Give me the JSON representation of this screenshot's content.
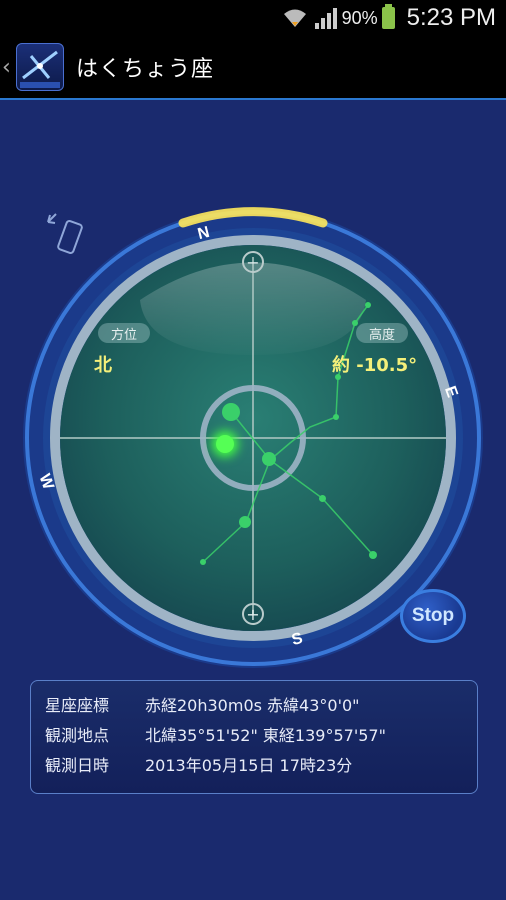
{
  "status_bar": {
    "battery_percent": "90%",
    "time": "5:23 PM"
  },
  "action_bar": {
    "back_icon": "chevron-left-icon",
    "app_icon": "constellation-app-icon",
    "title": "はくちょう座"
  },
  "compass": {
    "directions": {
      "north": "N",
      "east": "E",
      "south": "S",
      "west": "W"
    },
    "azimuth_label": "方位",
    "azimuth_value": "北",
    "altitude_label": "高度",
    "altitude_value": "約 -10.5°",
    "zoom_out": "−",
    "zoom_in": "+"
  },
  "stop_button": "Stop",
  "info": {
    "rows": [
      {
        "label": "星座座標",
        "value": "赤経20h30m0s 赤緯43°0'0\""
      },
      {
        "label": "観測地点",
        "value": "北緯35°51'52\" 東経139°57'57\""
      },
      {
        "label": "観測日時",
        "value": "2013年05月15日 17時23分"
      }
    ]
  },
  "colors": {
    "background": "#1a2a6e",
    "compass_face": "#1f6b63",
    "ring": "#2d5fb8",
    "star": "#33dd55",
    "label": "#f4f07a"
  }
}
